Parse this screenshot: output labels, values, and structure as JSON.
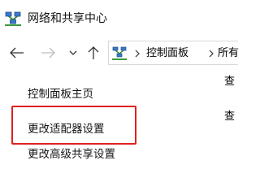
{
  "window": {
    "title": "网络和共享中心",
    "icon": "network-sharing-center-icon"
  },
  "navigation": {
    "back_icon": "back-arrow-icon",
    "forward_icon": "forward-arrow-icon",
    "recent_icon": "chevron-down-icon",
    "up_icon": "up-arrow-icon",
    "breadcrumbs": [
      "控制面板",
      "所有"
    ],
    "separator": ">"
  },
  "sidebar": {
    "links": [
      {
        "label": "控制面板主页"
      },
      {
        "label": "更改适配器设置"
      },
      {
        "label": "更改高级共享设置"
      }
    ],
    "highlight_color": "#e02020"
  },
  "main": {
    "fragments": [
      "查",
      "查"
    ]
  }
}
